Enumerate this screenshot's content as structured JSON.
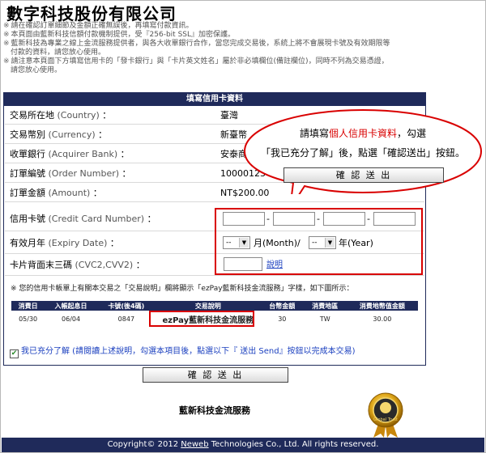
{
  "company_title": "數字科技股份有限公司",
  "notices": [
    "請在確認訂單細節及金額正確無誤後，再填寫付款資訊。",
    "本頁面由藍新科技信額付款機制提供，受『256-bit SSL』加密保護。",
    "藍新科技為專業之線上金流服務提供者，與各大收單銀行合作，當您完成交易後，系統上將不會展現卡號及有效期限等付款的資料，請您放心使用。",
    "請注意本頁面下方填寫信用卡的「發卡銀行」與「卡片英文姓名」屬於非必填欄位(備註欄位)，同時不列為交易憑證，請您放心使用。"
  ],
  "form": {
    "header": "填寫信用卡資料",
    "rows": [
      {
        "zh": "交易所在地",
        "en": "(Country)",
        "value": "臺灣"
      },
      {
        "zh": "交易幣別",
        "en": "(Currency)",
        "value": "新臺幣"
      },
      {
        "zh": "收單銀行",
        "en": "(Acquirer Bank)",
        "value": "安泰商"
      },
      {
        "zh": "訂單編號",
        "en": "(Order Number)",
        "value": "10000123"
      },
      {
        "zh": "訂單金額",
        "en": "(Amount)",
        "value": "NT$200.00"
      }
    ],
    "card_number": {
      "zh": "信用卡號",
      "en": "(Credit Card Number)",
      "sep": "-"
    },
    "expiry": {
      "zh": "有效月年",
      "en": "(Expiry Date)",
      "month_value": "--",
      "month_label": "月(Month)/",
      "year_value": "--",
      "year_label": "年(Year)"
    },
    "cvc": {
      "zh": "卡片背面末三碼",
      "en": "(CVC2,CVV2)",
      "link": "說明"
    },
    "colon": "："
  },
  "statement_note": "※ 您的信用卡帳單上有關本交易之「交易說明」欄將顯示「ezPay藍新科技金流服務」字樣，如下圖所示：",
  "statement_table": {
    "headers": [
      "消費日",
      "入帳起息日",
      "卡號(後4碼)",
      "交易說明",
      "台幣金額",
      "消費地區",
      "消費地幣值金額"
    ],
    "row": [
      "05/30",
      "06/04",
      "0847",
      "ezPay藍新科技金流服務",
      "30",
      "TW",
      "30.00"
    ]
  },
  "agree_text": "我已充分了解 (請閱讀上述說明，勾選本項目後，點選以下『 送出 Send』按鈕以完成本交易)",
  "submit_label": "確 認 送 出",
  "brand_text": "藍新科技金流服務",
  "medal_text": "Global Trust",
  "footer": {
    "prefix": "Copyright© 2012 ",
    "link": "Neweb",
    "suffix": " Technologies Co., Ltd. All rights reserved."
  },
  "bubble": {
    "line1_pre": "請填寫",
    "line1_red": "個人信用卡資料",
    "line1_post": "，勾選",
    "line2": "「我已充分了解」後，點選「確認送出」按鈕。",
    "button": "確 認 送 出"
  }
}
